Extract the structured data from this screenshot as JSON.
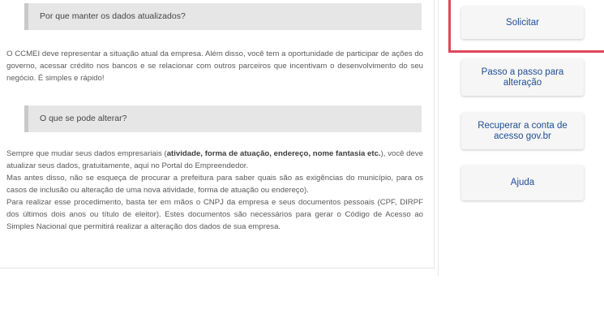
{
  "sections": [
    {
      "header": "Por que manter os dados atualizados?",
      "body": "O CCMEI deve representar a situação atual da empresa. Além disso, você tem a oportunidade de participar de ações do governo, acessar crédito nos bancos e se relacionar com outros parceiros que incentivam o desenvolvimento do seu negócio. É simples e rápido!"
    },
    {
      "header": "O que se pode alterar?",
      "intro": "Sempre que mudar seus dados empresariais (",
      "bold_terms": "atividade, forma de atuação, endereço, nome fantasia etc.",
      "after": "), você deve atualizar seus dados, gratuitamente, aqui no Portal do Empreendedor.",
      "para2": "Mas antes disso, não se esqueça de procurar a prefeitura para saber quais são as exigências do município, para os casos de inclusão ou alteração de uma nova atividade, forma de atuação ou endereço).",
      "para3": "Para realizar esse procedimento, basta ter em mãos o CNPJ da empresa e seus documentos pessoais (CPF, DIRPF dos últimos dois anos ou título de eleitor). Estes documentos são necessários para gerar o Código de Acesso ao Simples Nacional que permitirá realizar a alteração dos dados de sua empresa."
    }
  ],
  "sidebar": {
    "buttons": [
      "Solicitar",
      "Passo a passo para alteração",
      "Recuperar a conta de acesso gov.br",
      "Ajuda"
    ]
  },
  "colors": {
    "highlight": "#e0465a",
    "button_text": "#1f4e96",
    "header_bg": "#e6e6e6"
  }
}
